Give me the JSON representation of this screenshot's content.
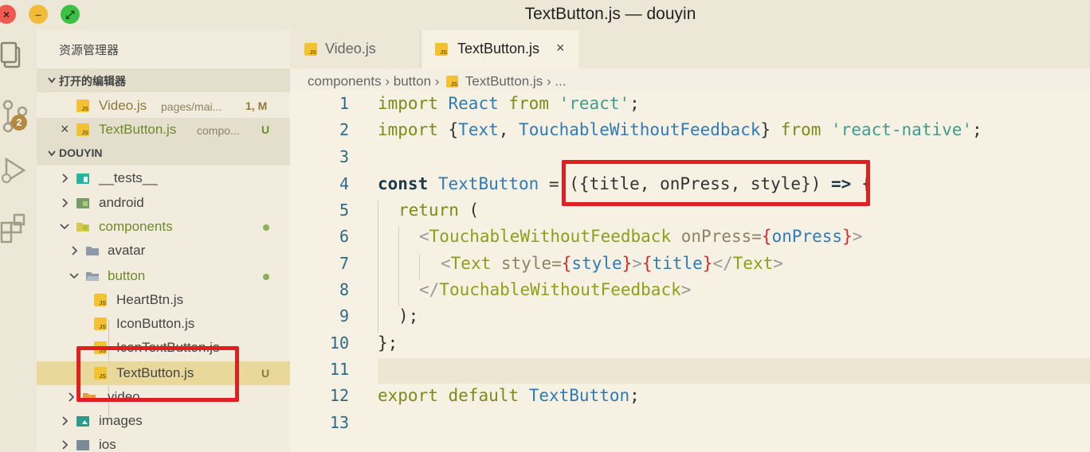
{
  "window": {
    "title": "TextButton.js — douyin"
  },
  "activity": {
    "scm_badge": "2"
  },
  "explorer": {
    "title": "资源管理器",
    "open_editors": {
      "header": "打开的编辑器",
      "items": [
        {
          "name": "Video.js",
          "path": "pages/mai...",
          "status": "1, M"
        },
        {
          "name": "TextButton.js",
          "path": "compo...",
          "status": "U"
        }
      ]
    },
    "project": {
      "header": "DOUYIN",
      "items": [
        {
          "name": "__tests__"
        },
        {
          "name": "android"
        },
        {
          "name": "components"
        },
        {
          "name": "avatar"
        },
        {
          "name": "button"
        },
        {
          "name": "HeartBtn.js"
        },
        {
          "name": "IconButton.js"
        },
        {
          "name": "IconTextButton.js"
        },
        {
          "name": "TextButton.js",
          "status": "U"
        },
        {
          "name": "video"
        },
        {
          "name": "images"
        },
        {
          "name": "ios"
        }
      ]
    }
  },
  "tabs": [
    {
      "label": "Video.js"
    },
    {
      "label": "TextButton.js",
      "close": "×"
    }
  ],
  "breadcrumb": {
    "parts": [
      "components",
      "button",
      "TextButton.js",
      "..."
    ],
    "sep": "›"
  },
  "editor": {
    "line_numbers": [
      "1",
      "2",
      "3",
      "4",
      "5",
      "6",
      "7",
      "8",
      "9",
      "10",
      "11",
      "12",
      "13"
    ],
    "code": {
      "l1": {
        "a": "import",
        "b": "React",
        "c": "from",
        "d": "'react'",
        "e": ";"
      },
      "l2": {
        "a": "import",
        "b": "{",
        "c": "Text",
        "d": ", ",
        "e": "TouchableWithoutFeedback",
        "f": "}",
        "g": "from",
        "h": "'react-native'",
        "i": ";"
      },
      "l4": {
        "a": "const",
        "b": "TextButton",
        "c": "=",
        "d": "({title, onPress, style})",
        "e": "=>",
        "f": "{"
      },
      "l5": {
        "a": "return",
        "b": "("
      },
      "l6": {
        "a": "<",
        "b": "TouchableWithoutFeedback",
        "c": "onPress",
        "d": "=",
        "e": "{",
        "f": "onPress",
        "g": "}",
        "h": ">"
      },
      "l7": {
        "a": "<",
        "b": "Text",
        "c": "style",
        "d": "=",
        "e": "{",
        "f": "style",
        "g": "}",
        "h": ">",
        "i": "{",
        "j": "title",
        "k": "}",
        "l": "</",
        "m": "Text",
        "n": ">"
      },
      "l8": {
        "a": "</",
        "b": "TouchableWithoutFeedback",
        "c": ">"
      },
      "l9": {
        "a": ");"
      },
      "l10": {
        "a": "};"
      },
      "l12": {
        "a": "export",
        "b": "default",
        "c": "TextButton",
        "d": ";"
      }
    }
  },
  "colors": {
    "annotation": "#e02020",
    "modified": "#8d7a3a",
    "untracked": "#6e8b2a"
  }
}
